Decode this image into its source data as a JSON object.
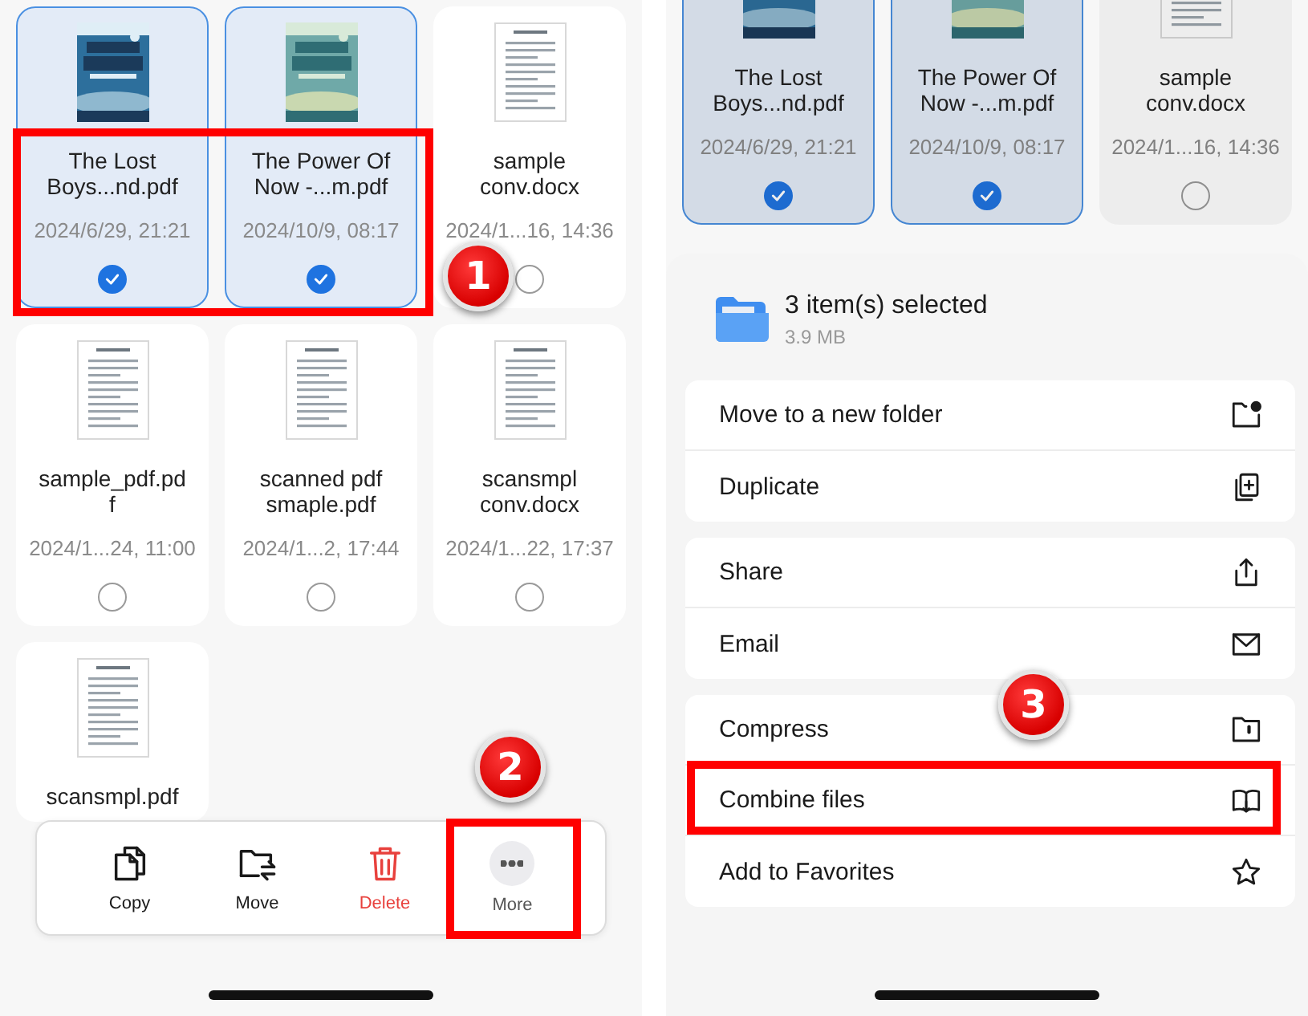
{
  "left_screen": {
    "files": [
      {
        "name": "The Lost Boys...nd.pdf",
        "date": "2024/6/29, 21:21",
        "selected": true,
        "kind": "cover"
      },
      {
        "name": "The Power Of Now -...m.pdf",
        "date": "2024/10/9, 08:17",
        "selected": true,
        "kind": "cover"
      },
      {
        "name": "sample conv.docx",
        "date": "2024/1...16, 14:36",
        "selected": false,
        "kind": "page"
      },
      {
        "name": "sample_pdf.pdf",
        "date": "2024/1...24, 11:00",
        "selected": false,
        "kind": "page"
      },
      {
        "name": "scanned pdf smaple.pdf",
        "date": "2024/1...2, 17:44",
        "selected": false,
        "kind": "page"
      },
      {
        "name": "scansmpl conv.docx",
        "date": "2024/1...22, 17:37",
        "selected": false,
        "kind": "page"
      },
      {
        "name": "scansmpl.pdf",
        "kind": "page"
      }
    ],
    "toolbar": [
      {
        "label": "Copy",
        "kind": "copy"
      },
      {
        "label": "Move",
        "kind": "move"
      },
      {
        "label": "Delete",
        "kind": "delete"
      },
      {
        "label": "More",
        "kind": "more"
      }
    ]
  },
  "right_screen": {
    "files": [
      {
        "name": "The Lost Boys...nd.pdf",
        "date": "2024/6/29, 21:21",
        "selected": true,
        "kind": "cover"
      },
      {
        "name": "The Power Of Now -...m.pdf",
        "date": "2024/10/9, 08:17",
        "selected": true,
        "kind": "cover"
      },
      {
        "name": "sample conv.docx",
        "date": "2024/1...16, 14:36",
        "selected": false,
        "kind": "page"
      }
    ],
    "sheet": {
      "title": "3 item(s) selected",
      "size": "3.9 MB",
      "groups": [
        [
          {
            "label": "Move to a new folder",
            "kind": "newfolder"
          },
          {
            "label": "Duplicate",
            "kind": "duplicate"
          }
        ],
        [
          {
            "label": "Share",
            "kind": "share"
          },
          {
            "label": "Email",
            "kind": "email"
          }
        ],
        [
          {
            "label": "Compress",
            "kind": "compress"
          },
          {
            "label": "Combine files",
            "kind": "combine"
          },
          {
            "label": "Add to Favorites",
            "kind": "favorite"
          }
        ]
      ]
    }
  },
  "annotations": [
    {
      "number": "1"
    },
    {
      "number": "2"
    },
    {
      "number": "3"
    }
  ]
}
